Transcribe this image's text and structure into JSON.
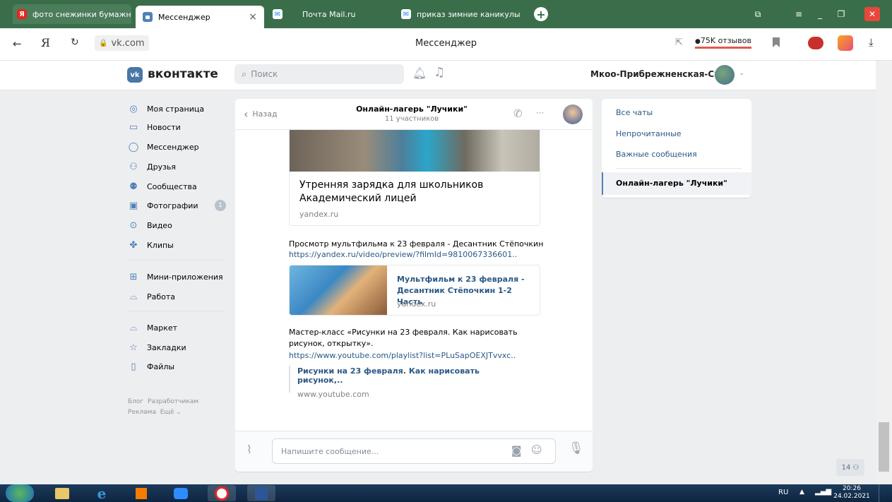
{
  "browser": {
    "tabs": [
      {
        "label": "фото снежинки бумажно"
      },
      {
        "label": "Мессенджер"
      },
      {
        "label": "Почта Mail.ru"
      },
      {
        "label": "приказ зимние каникулы"
      }
    ],
    "close_glyph": "×",
    "add_glyph": "+",
    "url": "vk.com",
    "page_title": "Мессенджер",
    "reviews": "75K отзывов",
    "yandex_glyph": "Я"
  },
  "vk": {
    "logo_text": "вконтакте",
    "logo_mark": "vk",
    "search_placeholder": "Поиск",
    "user_name": "Мкоо-Прибрежненская-Сш"
  },
  "sidebar": {
    "items": [
      {
        "label": "Моя страница",
        "icon": "user-circle-icon"
      },
      {
        "label": "Новости",
        "icon": "news-icon"
      },
      {
        "label": "Мессенджер",
        "icon": "chat-bubble-icon"
      },
      {
        "label": "Друзья",
        "icon": "friends-icon"
      },
      {
        "label": "Сообщества",
        "icon": "communities-icon"
      },
      {
        "label": "Фотографии",
        "icon": "photo-icon",
        "badge": "1"
      },
      {
        "label": "Видео",
        "icon": "play-icon"
      },
      {
        "label": "Клипы",
        "icon": "clips-icon"
      },
      {
        "label": "Мини-приложения",
        "icon": "apps-icon"
      },
      {
        "label": "Работа",
        "icon": "briefcase-icon"
      },
      {
        "label": "Маркет",
        "icon": "bag-icon"
      },
      {
        "label": "Закладки",
        "icon": "star-icon"
      },
      {
        "label": "Файлы",
        "icon": "file-icon"
      }
    ],
    "footer": {
      "blog": "Блог",
      "dev": "Разработчикам",
      "ads": "Реклама",
      "more": "Ещё"
    }
  },
  "chat": {
    "back_label": "Назад",
    "title": "Онлайн-лагерь \"Лучики\"",
    "subtitle": "11 участников",
    "more_glyph": "···",
    "messages": [
      {
        "card_title": "Утренняя зарядка для школьников Академический лицей",
        "card_domain": "yandex.ru"
      },
      {
        "text": "Просмотр мультфильма к 23 февраля - Десантник Стёпочкин",
        "url": "https://yandex.ru/video/preview/?filmId=9810067336601..",
        "card_title": "Мультфильм к 23 февраля - Десантник Стёпочкин 1-2 Часть",
        "card_domain": "yandex.ru"
      },
      {
        "text": "Мастер-класс «Рисунки на 23 февраля. Как нарисовать рисунок, открытку».",
        "url": "https://www.youtube.com/playlist?list=PLuSapOEXJTvvxc..",
        "card_title": "Рисунки на 23 февраля. Как нарисовать рисунок,..",
        "card_domain": "www.youtube.com"
      }
    ],
    "input_placeholder": "Напишите сообщение..."
  },
  "right_panel": {
    "links": [
      "Все чаты",
      "Непрочитанные",
      "Важные сообщения"
    ],
    "active_chat": "Онлайн-лагерь \"Лучики\""
  },
  "online_counter": "14",
  "taskbar": {
    "lang": "RU",
    "time": "20:26",
    "date": "24.02.2021"
  },
  "colors": {
    "accent": "#5181b8",
    "link": "#2a5885",
    "tabbar": "#3a6e4a"
  }
}
